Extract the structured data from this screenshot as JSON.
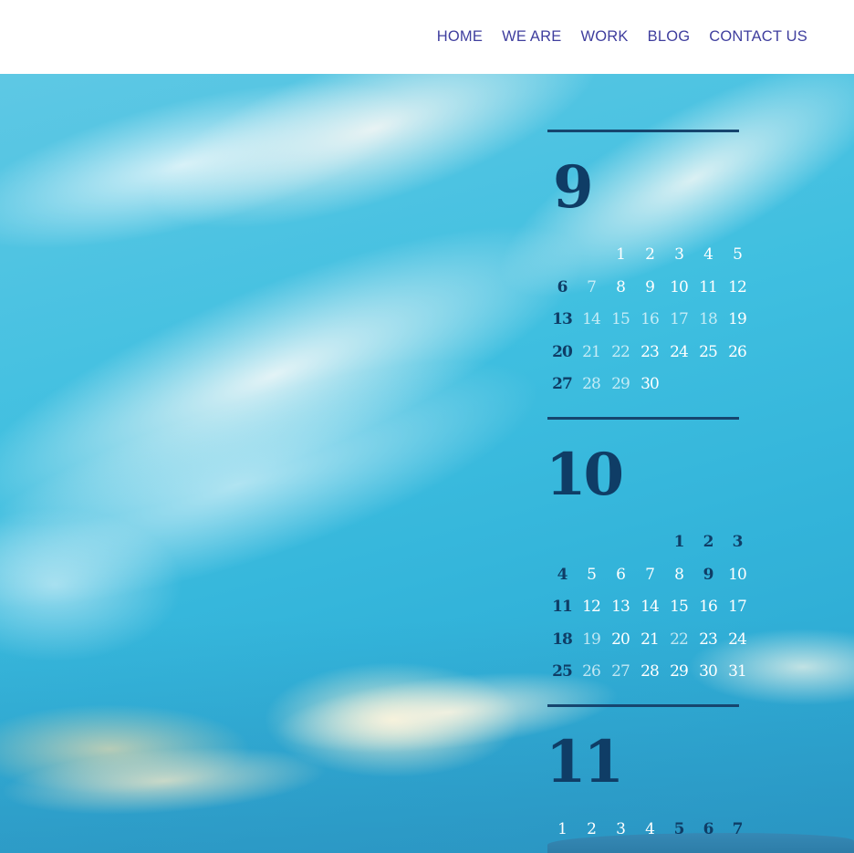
{
  "nav": {
    "items": [
      {
        "label": "HOME"
      },
      {
        "label": "WE ARE"
      },
      {
        "label": "WORK"
      },
      {
        "label": "BLOG"
      },
      {
        "label": "CONTACT US"
      }
    ]
  },
  "calendars": [
    {
      "month": "9",
      "rows": [
        [
          "",
          "",
          "1",
          "2",
          "3",
          "4",
          "5"
        ],
        [
          "6",
          "7",
          "8",
          "9",
          "10",
          "11",
          "12"
        ],
        [
          "13",
          "14",
          "15",
          "16",
          "17",
          "18",
          "19"
        ],
        [
          "20",
          "21",
          "22",
          "23",
          "24",
          "25",
          "26"
        ],
        [
          "27",
          "28",
          "29",
          "30",
          "",
          "",
          ""
        ]
      ]
    },
    {
      "month": "10",
      "rows": [
        [
          "",
          "",
          "",
          "",
          "1",
          "2",
          "3"
        ],
        [
          "4",
          "5",
          "6",
          "7",
          "8",
          "9",
          "10"
        ],
        [
          "11",
          "12",
          "13",
          "14",
          "15",
          "16",
          "17"
        ],
        [
          "18",
          "19",
          "20",
          "21",
          "22",
          "23",
          "24"
        ],
        [
          "25",
          "26",
          "27",
          "28",
          "29",
          "30",
          "31"
        ]
      ]
    },
    {
      "month": "11",
      "rows": [
        [
          "1",
          "2",
          "3",
          "4",
          "5",
          "6",
          "7"
        ]
      ]
    }
  ],
  "colors": {
    "nav_text": "#3f3e9e",
    "calendar_dark": "#0f3d66",
    "sky": "#3fbfe0"
  }
}
